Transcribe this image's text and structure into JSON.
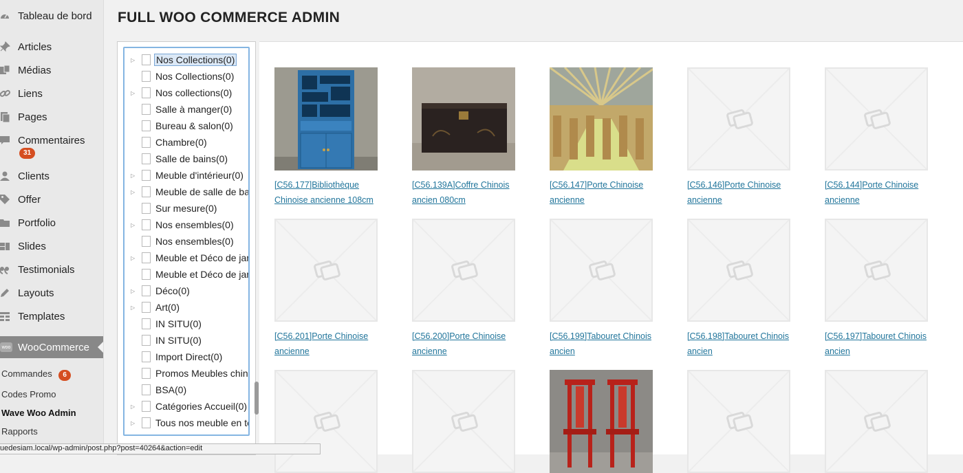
{
  "sidebar": {
    "items": [
      {
        "label": "Tableau de bord",
        "icon": "dashboard-icon"
      },
      {
        "label": "Articles",
        "icon": "pin-icon"
      },
      {
        "label": "Médias",
        "icon": "media-icon"
      },
      {
        "label": "Liens",
        "icon": "link-icon"
      },
      {
        "label": "Pages",
        "icon": "pages-icon"
      },
      {
        "label": "Commentaires",
        "icon": "comment-icon"
      },
      {
        "label": "Clients",
        "icon": "users-icon"
      },
      {
        "label": "Offer",
        "icon": "tag-icon"
      },
      {
        "label": "Portfolio",
        "icon": "folder-icon"
      },
      {
        "label": "Slides",
        "icon": "slides-icon"
      },
      {
        "label": "Testimonials",
        "icon": "quote-icon"
      },
      {
        "label": "Layouts",
        "icon": "pencil-icon"
      },
      {
        "label": "Templates",
        "icon": "grid-icon"
      }
    ],
    "comments_badge": "31",
    "woocommerce": {
      "label": "WooCommerce",
      "icon_text": "woo"
    },
    "submenu": [
      {
        "label": "Commandes",
        "badge": "6"
      },
      {
        "label": "Codes Promo"
      },
      {
        "label": "Wave Woo Admin"
      },
      {
        "label": "Rapports"
      }
    ]
  },
  "header": {
    "title": "FULL WOO COMMERCE ADMIN"
  },
  "tree": {
    "items": [
      {
        "label": "Nos Collections(0)",
        "expandable": true,
        "selected": true
      },
      {
        "label": "Nos Collections(0)",
        "expandable": false
      },
      {
        "label": "Nos collections(0)",
        "expandable": true
      },
      {
        "label": "Salle à manger(0)",
        "expandable": false
      },
      {
        "label": "Bureau & salon(0)",
        "expandable": false
      },
      {
        "label": "Chambre(0)",
        "expandable": false
      },
      {
        "label": "Salle de bains(0)",
        "expandable": false
      },
      {
        "label": "Meuble d'intérieur(0)",
        "expandable": true
      },
      {
        "label": "Meuble de salle de bai",
        "expandable": true
      },
      {
        "label": "Sur mesure(0)",
        "expandable": false
      },
      {
        "label": "Nos ensembles(0)",
        "expandable": true
      },
      {
        "label": "Nos ensembles(0)",
        "expandable": false
      },
      {
        "label": "Meuble et Déco de jar",
        "expandable": true
      },
      {
        "label": "Meuble et Déco de jar",
        "expandable": false
      },
      {
        "label": "Déco(0)",
        "expandable": true
      },
      {
        "label": "Art(0)",
        "expandable": true
      },
      {
        "label": "IN SITU(0)",
        "expandable": false
      },
      {
        "label": "IN SITU(0)",
        "expandable": false
      },
      {
        "label": "Import Direct(0)",
        "expandable": false
      },
      {
        "label": "Promos Meubles chino",
        "expandable": false
      },
      {
        "label": "BSA(0)",
        "expandable": false
      },
      {
        "label": "Catégories Accueil(0)",
        "expandable": true
      },
      {
        "label": "Tous nos meuble en te",
        "expandable": true
      }
    ]
  },
  "products": [
    {
      "line1": "[C56.177]Bibliothèque",
      "line2": "Chinoise ancienne 108cm",
      "image": "blue-cabinet"
    },
    {
      "line1": "[C56.139A]Coffre Chinois",
      "line2": "ancien 080cm",
      "image": "black-chest"
    },
    {
      "line1": "[C56.147]Porte Chinoise",
      "line2": "ancienne",
      "image": "warehouse"
    },
    {
      "line1": "[C56.146]Porte Chinoise",
      "line2": "ancienne",
      "image": "placeholder"
    },
    {
      "line1": "[C56.144]Porte Chinoise",
      "line2": "ancienne",
      "image": "placeholder"
    },
    {
      "line1": "[C56.201]Porte Chinoise",
      "line2": "ancienne",
      "image": "placeholder"
    },
    {
      "line1": "[C56.200]Porte Chinoise",
      "line2": "ancienne",
      "image": "placeholder"
    },
    {
      "line1": "[C56.199]Tabouret Chinois",
      "line2": "ancien",
      "image": "placeholder"
    },
    {
      "line1": "[C56.198]Tabouret Chinois",
      "line2": "ancien",
      "image": "placeholder"
    },
    {
      "line1": "[C56.197]Tabouret Chinois",
      "line2": "ancien",
      "image": "placeholder"
    },
    {
      "line1": "",
      "line2": "",
      "image": "placeholder"
    },
    {
      "line1": "",
      "line2": "",
      "image": "placeholder"
    },
    {
      "line1": "",
      "line2": "",
      "image": "red-chairs"
    },
    {
      "line1": "",
      "line2": "",
      "image": "placeholder"
    },
    {
      "line1": "",
      "line2": "",
      "image": "placeholder"
    }
  ],
  "status_bar": {
    "url": "uedesiam.local/wp-admin/post.php?post=40264&action=edit"
  },
  "colors": {
    "link": "#21759b",
    "badge": "#d54e21",
    "selection_border": "#84b5e2"
  }
}
